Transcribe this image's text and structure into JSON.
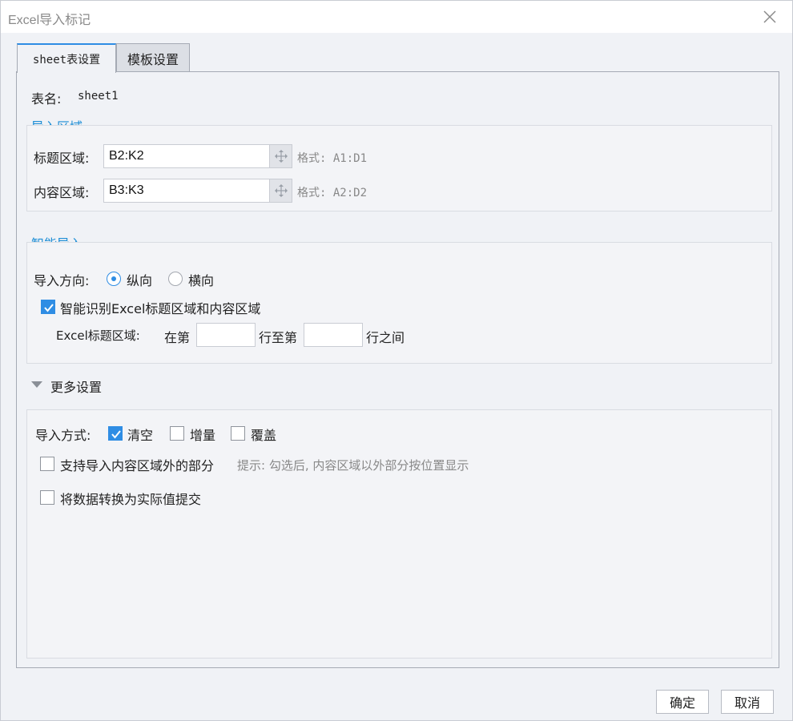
{
  "window": {
    "title": "Excel导入标记"
  },
  "tabs": [
    {
      "label": "sheet表设置",
      "active": true
    },
    {
      "label": "模板设置",
      "active": false
    }
  ],
  "sheet": {
    "name_label": "表名:",
    "name_value": "sheet1"
  },
  "import_area": {
    "title": "导入区域",
    "header": {
      "label": "标题区域:",
      "value": "B2:K2",
      "format": "格式: A1:D1"
    },
    "content": {
      "label": "内容区域:",
      "value": "B3:K3",
      "format": "格式: A2:D2"
    }
  },
  "smart_import": {
    "title": "智能导入",
    "direction_label": "导入方向:",
    "direction_options": [
      {
        "label": "纵向",
        "selected": true
      },
      {
        "label": "横向",
        "selected": false
      }
    ],
    "auto_detect_label": "智能识别Excel标题区域和内容区域",
    "auto_detect_checked": true,
    "header_range_label": "Excel标题区域:",
    "range_from_label": "在第",
    "range_to_label": "行至第",
    "range_end_label": "行之间",
    "from_value": "",
    "to_value": ""
  },
  "more_settings": {
    "title": "更多设置",
    "mode_label": "导入方式:",
    "mode_options": [
      {
        "label": "清空",
        "checked": true
      },
      {
        "label": "增量",
        "checked": false
      },
      {
        "label": "覆盖",
        "checked": false
      }
    ],
    "outside_label": "支持导入内容区域外的部分",
    "outside_hint": "提示: 勾选后, 内容区域以外部分按位置显示",
    "outside_checked": false,
    "convert_label": "将数据转换为实际值提交",
    "convert_checked": false
  },
  "footer": {
    "ok_label": "确定",
    "cancel_label": "取消"
  },
  "colors": {
    "accent": "#2f8de4",
    "section_title": "#1f8fd6"
  }
}
